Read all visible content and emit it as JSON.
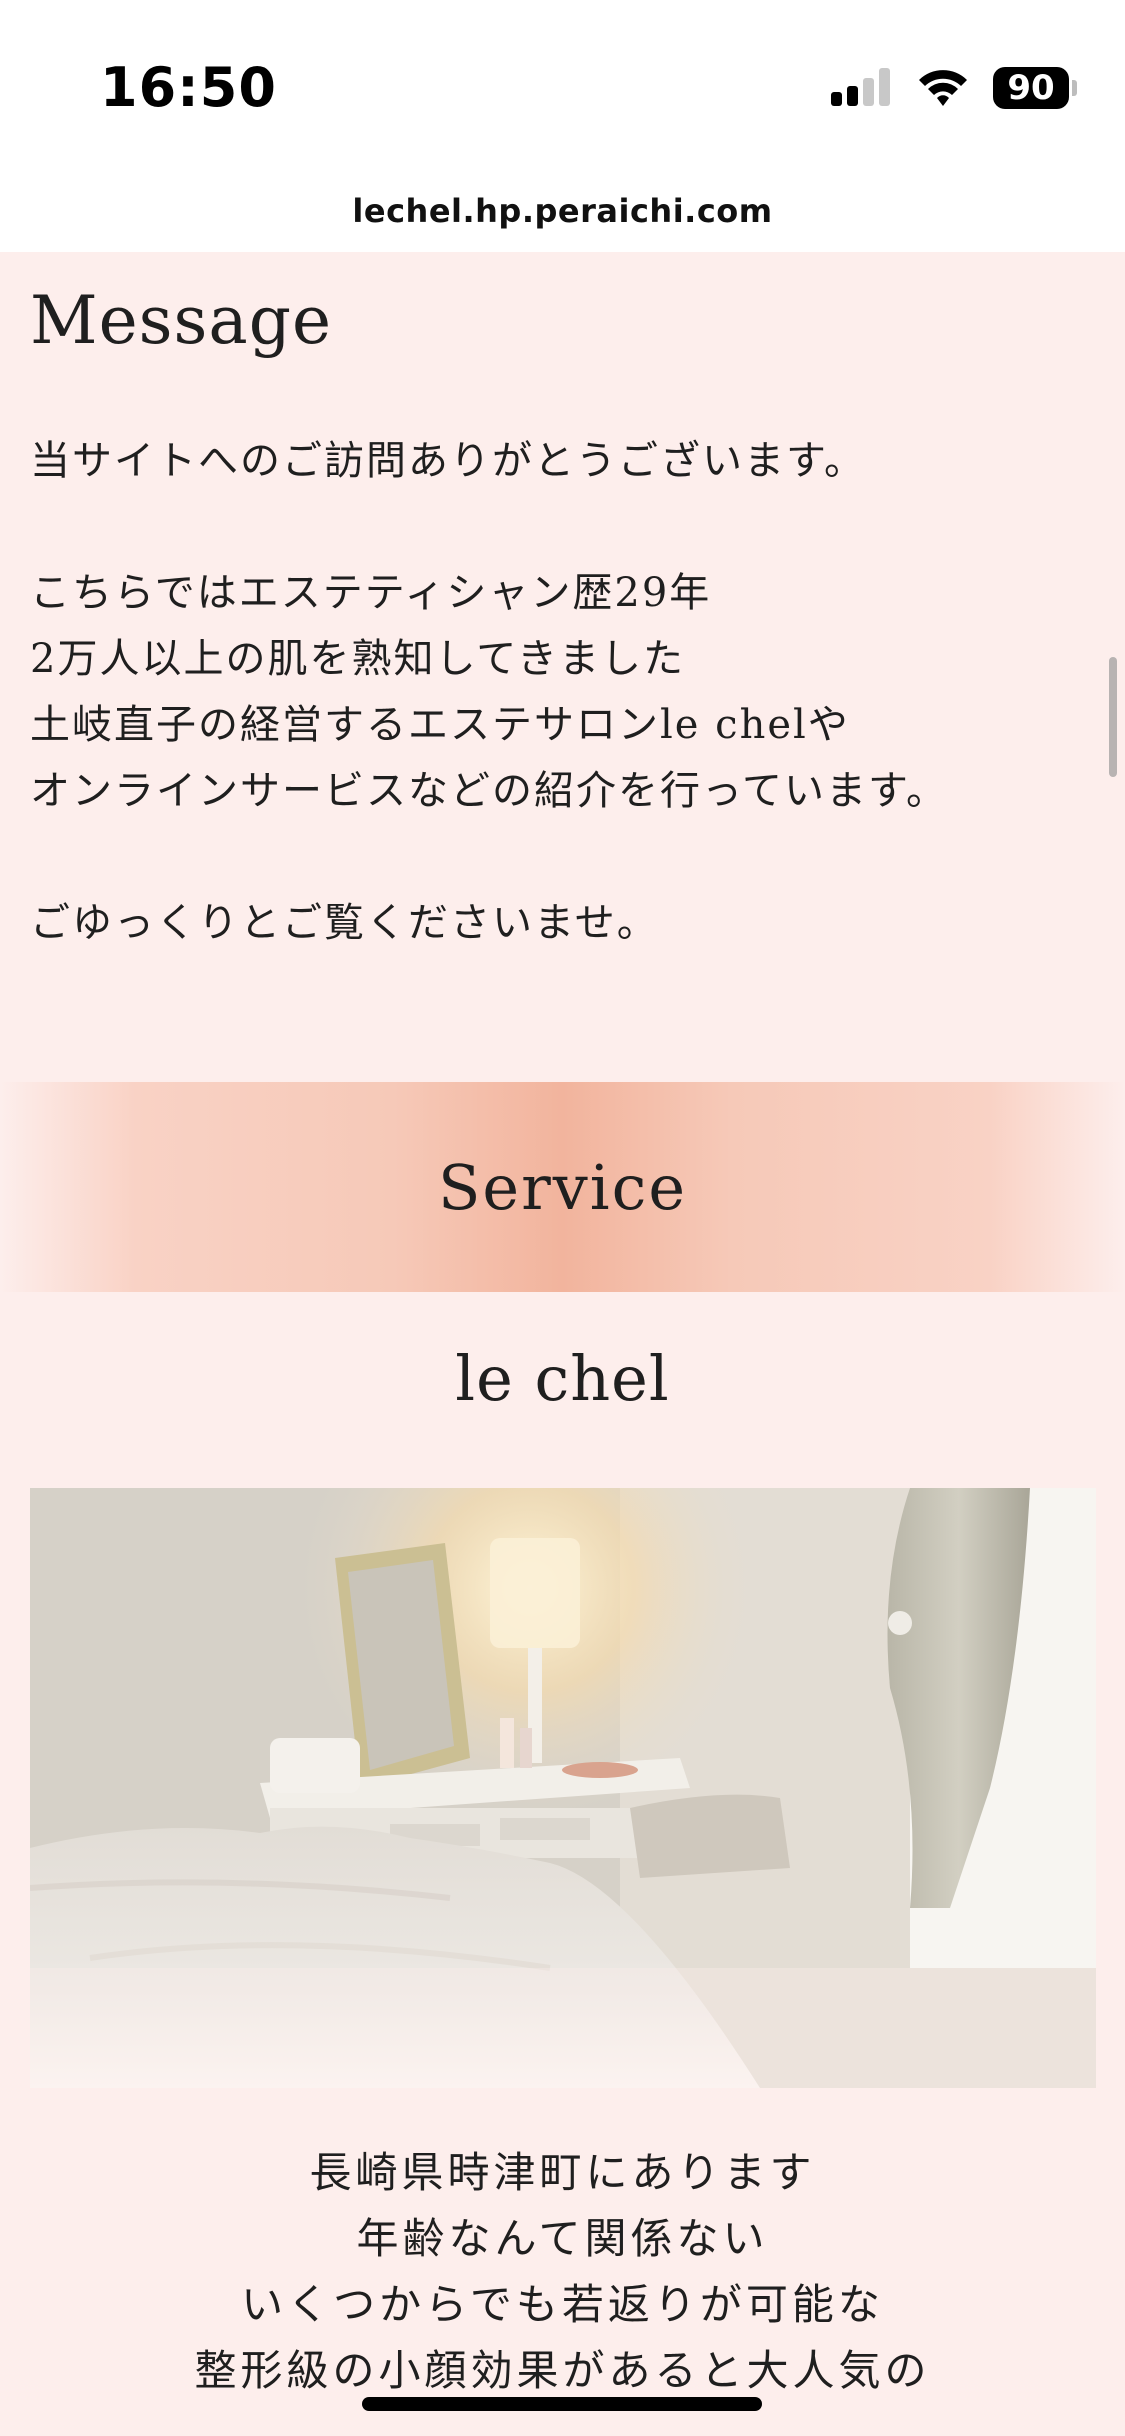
{
  "status_bar": {
    "time": "16:50",
    "battery": "90",
    "icons": [
      "cellular-signal-icon",
      "wifi-icon",
      "battery-icon"
    ]
  },
  "browser": {
    "url": "lechel.hp.peraichi.com"
  },
  "message": {
    "title": "Message",
    "para1": [
      "当サイトへのご訪問ありがとうございます。"
    ],
    "para2": [
      "こちらではエステティシャン歴29年",
      "2万人以上の肌を熟知してきました",
      "土岐直子の経営するエステサロンle chelや",
      "オンラインサービスなどの紹介を行っています。"
    ],
    "para3": [
      "ごゆっくりとご覧くださいませ。"
    ]
  },
  "service": {
    "heading": "Service",
    "item_title": "le chel",
    "description": [
      "長崎県時津町にあります",
      "年齢なんて関係ない",
      "いくつからでも若返りが可能な",
      "整形級の小顔効果があると大人気の"
    ]
  },
  "colors": {
    "page_bg": "#fdeeec",
    "band_accent": "#f2b49d"
  }
}
